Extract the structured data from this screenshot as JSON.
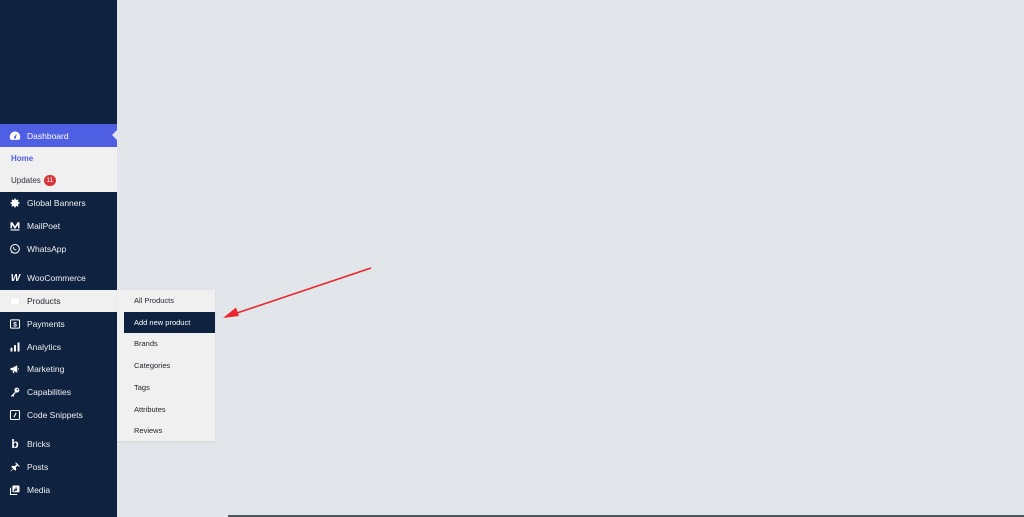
{
  "sidebar": {
    "dashboard": {
      "label": "Dashboard",
      "icon": "dashboard-gauge-icon"
    },
    "dashboard_sub": [
      {
        "label": "Home"
      },
      {
        "label": "Updates",
        "badge": "11"
      }
    ],
    "items": [
      {
        "label": "Global Banners",
        "icon": "gear-icon"
      },
      {
        "label": "MailPoet",
        "icon": "mailpoet-icon"
      },
      {
        "label": "WhatsApp",
        "icon": "whatsapp-icon"
      },
      {
        "label": "WooCommerce",
        "icon": "woocommerce-icon"
      },
      {
        "label": "Products",
        "icon": "products-box-icon"
      },
      {
        "label": "Payments",
        "icon": "payments-icon"
      },
      {
        "label": "Analytics",
        "icon": "bar-chart-icon"
      },
      {
        "label": "Marketing",
        "icon": "megaphone-icon"
      },
      {
        "label": "Capabilities",
        "icon": "key-icon"
      },
      {
        "label": "Code Snippets",
        "icon": "code-icon"
      },
      {
        "label": "Bricks",
        "icon": "bricks-b-icon"
      },
      {
        "label": "Posts",
        "icon": "pushpin-icon"
      },
      {
        "label": "Media",
        "icon": "media-icon"
      }
    ]
  },
  "products_flyout": [
    {
      "label": "All Products"
    },
    {
      "label": "Add new product"
    },
    {
      "label": "Brands"
    },
    {
      "label": "Categories"
    },
    {
      "label": "Tags"
    },
    {
      "label": "Attributes"
    },
    {
      "label": "Reviews"
    }
  ],
  "colors": {
    "sidebar_bg": "#0f2240",
    "accent": "#4f5fe3",
    "canvas_bg": "#e2e6ea",
    "arrow": "#e8262b",
    "badge": "#d63638"
  }
}
